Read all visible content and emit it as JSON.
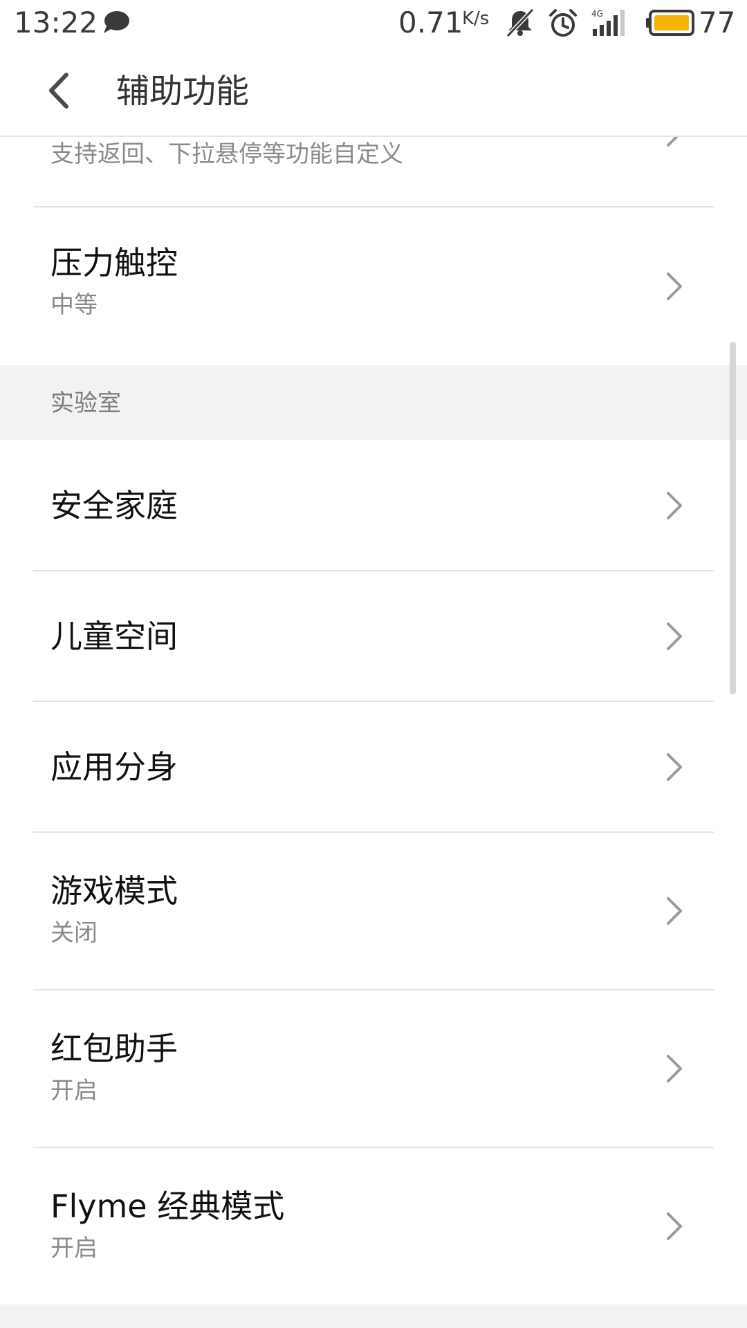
{
  "status_bar": {
    "time": "13:22",
    "net_speed": "0.71",
    "net_unit": "K/s",
    "network_type": "4G",
    "battery_level": "77",
    "icons": [
      "chat-bubble-icon",
      "mute-bell-icon",
      "alarm-icon",
      "signal-icon",
      "battery-icon"
    ],
    "battery_color": "#f5b400"
  },
  "app_bar": {
    "title": "辅助功能",
    "back_icon": "chevron-left-icon"
  },
  "rows": [
    {
      "id": "partial",
      "label": "",
      "sub": "支持返回、下拉悬停等功能自定义"
    },
    {
      "id": "pressure-touch",
      "label": "压力触控",
      "sub": "中等"
    },
    {
      "id": "safe-family",
      "label": "安全家庭",
      "sub": ""
    },
    {
      "id": "kids-space",
      "label": "儿童空间",
      "sub": ""
    },
    {
      "id": "app-clone",
      "label": "应用分身",
      "sub": ""
    },
    {
      "id": "game-mode",
      "label": "游戏模式",
      "sub": "关闭"
    },
    {
      "id": "red-packet",
      "label": "红包助手",
      "sub": "开启"
    },
    {
      "id": "flyme-classic",
      "label": "Flyme 经典模式",
      "sub": "开启"
    }
  ],
  "sections": {
    "lab": "实验室"
  },
  "colors": {
    "section_bg": "#f2f2f2",
    "divider": "#e3e3e3",
    "sub_text": "#8a8a8a",
    "chevron": "#9a9a9a"
  }
}
